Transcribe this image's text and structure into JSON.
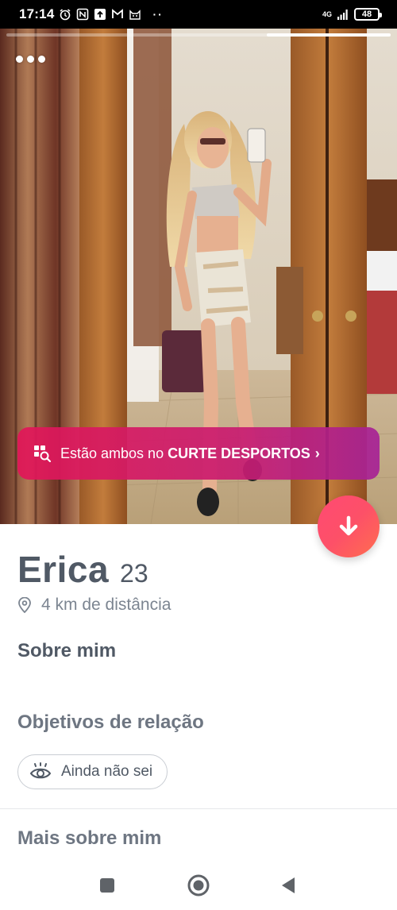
{
  "status_bar": {
    "time": "17:14",
    "overflow": "··",
    "network": "4G",
    "battery": "48",
    "icons": [
      "alarm-icon",
      "nfc-icon",
      "upload-icon",
      "gmail-icon",
      "cat-icon",
      "signal-icon",
      "battery-icon"
    ]
  },
  "photo": {
    "progress": 0.33,
    "shared_banner": {
      "prefix": "Estão ambos no",
      "highlight": "CURTE DESPORTOS",
      "chevron": "›",
      "icon": "search-grid-icon"
    }
  },
  "profile": {
    "name": "Erica",
    "age": "23",
    "distance": "4 km de distância",
    "about_title": "Sobre mim",
    "goals_title": "Objetivos de relação",
    "goal_value": "Ainda não sei",
    "more_title": "Mais sobre mim"
  },
  "colors": {
    "accent": "#fd5068",
    "banner_start": "#e21658",
    "banner_end": "#a62296",
    "text": "#505965"
  },
  "nav": {
    "icons": [
      "recent-apps-icon",
      "home-icon",
      "back-icon"
    ]
  }
}
